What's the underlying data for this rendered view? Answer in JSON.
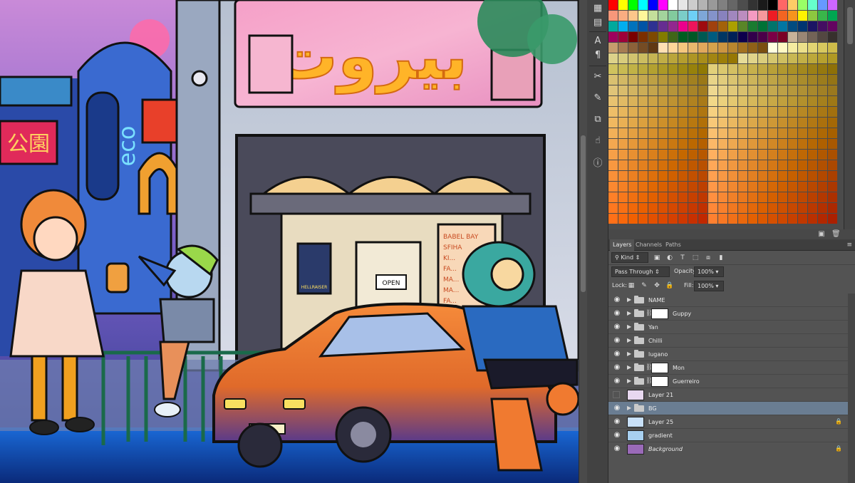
{
  "canvas": {
    "sign_text": "بيروت",
    "eco_sign": "eco",
    "chinese_sign": "公園",
    "menu_board": [
      "BABEL BAY",
      "SFIHA",
      "KI...",
      "FA...",
      "MA...",
      "MA...",
      "FA..."
    ],
    "poster_text": "HELLRAISER",
    "door_sign": "OPEN"
  },
  "iconstrip": {
    "icons": [
      "swatches-icon",
      "character-icon",
      "paragraph-icon",
      "tools-icon",
      "brush-presets-icon",
      "clone-source-icon",
      "actions-icon",
      "info-icon"
    ]
  },
  "swatches": {
    "colors": [
      [
        "#ff0000",
        "#ffff00",
        "#00ff00",
        "#00ffff",
        "#0000ff",
        "#ff00ff",
        "#ffffff",
        "#e6e6e6",
        "#cccccc",
        "#b3b3b3",
        "#999999",
        "#808080",
        "#666666",
        "#4d4d4d",
        "#333333",
        "#1a1a1a",
        "#000000",
        "#ff6666",
        "#ffcc66",
        "#99ff66",
        "#66ffcc",
        "#6699ff",
        "#cc66ff"
      ],
      [
        "#f7977a",
        "#f9ad81",
        "#fdc68a",
        "#fff79a",
        "#c4df9b",
        "#a3d39c",
        "#82ca9d",
        "#7bcdc8",
        "#6ecff6",
        "#7ea7d8",
        "#8493ca",
        "#8882be",
        "#a187be",
        "#bc8dbf",
        "#f49ac2",
        "#f6989d",
        "#ed1c24",
        "#f26522",
        "#f7941d",
        "#fff200",
        "#8dc73f",
        "#39b54a",
        "#00a651"
      ],
      [
        "#00a99d",
        "#00aeef",
        "#0072bc",
        "#0054a6",
        "#2e3192",
        "#662d91",
        "#92278f",
        "#ec008c",
        "#ed145b",
        "#9e0b0f",
        "#a0410d",
        "#a36209",
        "#aba000",
        "#598527",
        "#1a7b30",
        "#007236",
        "#00746b",
        "#0076a3",
        "#004b80",
        "#003471",
        "#1b1464",
        "#440e62",
        "#630460"
      ],
      [
        "#9e005d",
        "#9e0039",
        "#790000",
        "#7b2e00",
        "#7d4900",
        "#827b00",
        "#406618",
        "#005e20",
        "#005826",
        "#005952",
        "#005b7f",
        "#003663",
        "#002157",
        "#0d004c",
        "#32004b",
        "#4b0049",
        "#7b0046",
        "#7a0026",
        "#c7b299",
        "#998675",
        "#736357",
        "#534741",
        "#37302d"
      ],
      [
        "#c69c6d",
        "#a67c52",
        "#8c6239",
        "#754c24",
        "#603913",
        "#ffe0b3",
        "#ffd699",
        "#f5c77e",
        "#e8b86d",
        "#e0a85c",
        "#d4a24c",
        "#cc9540",
        "#b8862e",
        "#a37220",
        "#8f6018",
        "#7a4f10",
        "#ffffe0",
        "#fff8c4",
        "#f5eba0",
        "#ece08a",
        "#e2d472",
        "#d8c85e",
        "#cfbc4a"
      ],
      [
        "#ddd28a",
        "#d8cc7c",
        "#d2c46e",
        "#ccbd60",
        "#c6b553",
        "#c0ad46",
        "#baa53a",
        "#b49d2e",
        "#ae9524",
        "#a88d1a",
        "#a28512",
        "#9c7e0a",
        "#967704",
        "#e6dc98",
        "#e0d48a",
        "#dacd7c",
        "#d4c66e",
        "#cebe60",
        "#c8b753",
        "#c2af46",
        "#bca83a",
        "#b6a02e",
        "#b09924"
      ],
      [
        "#cfc25e",
        "#c8ba52",
        "#c1b246",
        "#baa93b",
        "#b3a130",
        "#ac9926",
        "#a5911c",
        "#9e8913",
        "#97810b",
        "#907904",
        "#e2d07a",
        "#dbc86e",
        "#d4c062",
        "#cdb857",
        "#c6b04c",
        "#bfa842",
        "#b8a038",
        "#b1982f",
        "#aa9026",
        "#a3881e",
        "#9c8016",
        "#95780f",
        "#8e7008"
      ],
      [
        "#d9c070",
        "#d2b864",
        "#cbb059",
        "#c4a84e",
        "#bda044",
        "#b6983a",
        "#af9031",
        "#a88828",
        "#a18020",
        "#9a7818",
        "#e8d488",
        "#e1cc7c",
        "#dac470",
        "#d3bc65",
        "#ccb45a",
        "#c5ac50",
        "#bea446",
        "#b79c3d",
        "#b09434",
        "#a98c2c",
        "#a28424",
        "#9b7c1d",
        "#947416"
      ],
      [
        "#e0c478",
        "#d9bc6c",
        "#d2b461",
        "#cbac56",
        "#c4a44c",
        "#bd9c42",
        "#b69439",
        "#af8c30",
        "#a88428",
        "#a17c20",
        "#eed890",
        "#e7d084",
        "#e0c878",
        "#d9c06d",
        "#d2b862",
        "#cbb058",
        "#c4a84e",
        "#bda045",
        "#b6983c",
        "#af9034",
        "#a8882c",
        "#a18025",
        "#9a781e"
      ],
      [
        "#e8c270",
        "#e1ba64",
        "#dab259",
        "#d3aa4e",
        "#cca244",
        "#c59a3a",
        "#be9231",
        "#b78a28",
        "#b08220",
        "#a97a18",
        "#f2d888",
        "#ebd07c",
        "#e4c870",
        "#ddc065",
        "#d6b85a",
        "#cfb050",
        "#c8a846",
        "#c1a03d",
        "#ba9834",
        "#b3902c",
        "#ac8824",
        "#a5801d",
        "#9e7816"
      ],
      [
        "#eebe68",
        "#e7b65c",
        "#e0ae51",
        "#d9a646",
        "#d29e3c",
        "#cb9632",
        "#c48e29",
        "#bd8620",
        "#b67e18",
        "#af7610",
        "#f6d080",
        "#efc874",
        "#e8c068",
        "#e1b85d",
        "#dab052",
        "#d3a848",
        "#cca03e",
        "#c59835",
        "#be902c",
        "#b78824",
        "#b0801c",
        "#a97815",
        "#a2700e"
      ],
      [
        "#f0b860",
        "#e9b054",
        "#e2a849",
        "#dba03e",
        "#d49834",
        "#cd902a",
        "#c68821",
        "#bf8018",
        "#b87810",
        "#b17008",
        "#f8c878",
        "#f1c06c",
        "#eab860",
        "#e3b055",
        "#dca84a",
        "#d5a040",
        "#ce9836",
        "#c7902d",
        "#c08824",
        "#b9801c",
        "#b27814",
        "#ab700d",
        "#a46806"
      ],
      [
        "#f2b058",
        "#eba84c",
        "#e4a041",
        "#dd9836",
        "#d6902c",
        "#cf8822",
        "#c88019",
        "#c17810",
        "#ba7008",
        "#b36800",
        "#fac070",
        "#f3b864",
        "#ecb058",
        "#e5a84d",
        "#dea042",
        "#d79838",
        "#d0902e",
        "#c98825",
        "#c2801c",
        "#bb7814",
        "#b4700c",
        "#ad6805",
        "#a66000"
      ],
      [
        "#f4a850",
        "#eda044",
        "#e69839",
        "#df902e",
        "#d88824",
        "#d1801a",
        "#ca7811",
        "#c37008",
        "#bc6800",
        "#b56000",
        "#fcb868",
        "#f5b05c",
        "#eea850",
        "#e7a045",
        "#e0983a",
        "#d99030",
        "#d28826",
        "#cb801d",
        "#c47814",
        "#bd700c",
        "#b66804",
        "#af6000",
        "#a85800"
      ],
      [
        "#f6a048",
        "#ef983c",
        "#e89031",
        "#e18826",
        "#da801c",
        "#d37812",
        "#cc7009",
        "#c56800",
        "#be6000",
        "#b75800",
        "#feb060",
        "#f7a854",
        "#f0a048",
        "#e9983d",
        "#e29032",
        "#db8828",
        "#d4801e",
        "#cd7815",
        "#c6700c",
        "#bf6804",
        "#b86000",
        "#b15800",
        "#aa5000"
      ],
      [
        "#f89840",
        "#f19034",
        "#ea8829",
        "#e3801e",
        "#dc7814",
        "#d5700a",
        "#ce6801",
        "#c76000",
        "#c05800",
        "#b95000",
        "#ffa858",
        "#f8a04c",
        "#f19840",
        "#ea9035",
        "#e3882a",
        "#dc8020",
        "#d57816",
        "#ce700d",
        "#c76804",
        "#c06000",
        "#b95800",
        "#b25000",
        "#ab4800"
      ],
      [
        "#fa9038",
        "#f3882c",
        "#ec8021",
        "#e57816",
        "#de700c",
        "#d76802",
        "#d06000",
        "#c95800",
        "#c25000",
        "#bb4800",
        "#ffa050",
        "#f89844",
        "#f19038",
        "#ea882d",
        "#e38022",
        "#dc7818",
        "#d5700e",
        "#ce6805",
        "#c76000",
        "#c05800",
        "#b95000",
        "#b24800",
        "#ab4000"
      ],
      [
        "#fc8830",
        "#f58024",
        "#ee7819",
        "#e7700e",
        "#e06804",
        "#d96000",
        "#d25800",
        "#cb5000",
        "#c44800",
        "#bd4000",
        "#ff9848",
        "#f8903c",
        "#f18830",
        "#ea8025",
        "#e3781a",
        "#dc7010",
        "#d56806",
        "#ce6000",
        "#c75800",
        "#c05000",
        "#b94800",
        "#b24000",
        "#ab3800"
      ],
      [
        "#fe8028",
        "#f7781c",
        "#f07011",
        "#e96806",
        "#e26000",
        "#db5800",
        "#d45000",
        "#cd4800",
        "#c64000",
        "#bf3800",
        "#ff9040",
        "#f88834",
        "#f18028",
        "#ea781d",
        "#e37012",
        "#dc6808",
        "#d56000",
        "#ce5800",
        "#c75000",
        "#c04800",
        "#b94000",
        "#b23800",
        "#ab3000"
      ],
      [
        "#ff7820",
        "#f87014",
        "#f16809",
        "#ea6000",
        "#e35800",
        "#dc5000",
        "#d54800",
        "#ce4000",
        "#c73800",
        "#c03000",
        "#ff8838",
        "#f8802c",
        "#f17820",
        "#ea7015",
        "#e3680a",
        "#dc6000",
        "#d55800",
        "#ce5000",
        "#c74800",
        "#c04000",
        "#b93800",
        "#b23000",
        "#ab2800"
      ],
      [
        "#ff7018",
        "#f8680c",
        "#f16001",
        "#ea5800",
        "#e35000",
        "#dc4800",
        "#d54000",
        "#ce3800",
        "#c73000",
        "#c02800",
        "#ff8030",
        "#f87824",
        "#f17018",
        "#ea680d",
        "#e36002",
        "#dc5800",
        "#d55000",
        "#ce4800",
        "#c74000",
        "#c03800",
        "#b93000",
        "#b22800",
        "#ab2000"
      ]
    ]
  },
  "layers_panel": {
    "tabs": [
      "Layers",
      "Channels",
      "Paths"
    ],
    "filter_kind": "Kind",
    "blend_mode": "Pass Through",
    "opacity_label": "Opacity:",
    "opacity_value": "100%",
    "lock_label": "Lock:",
    "fill_label": "Fill:",
    "fill_value": "100%",
    "layers": [
      {
        "name": "NAME",
        "type": "group",
        "visible": true,
        "mask": false,
        "selected": false,
        "locked": false,
        "italic": false
      },
      {
        "name": "Guppy",
        "type": "group",
        "visible": true,
        "mask": true,
        "selected": false,
        "locked": false,
        "italic": false
      },
      {
        "name": "Yan",
        "type": "group",
        "visible": true,
        "mask": false,
        "selected": false,
        "locked": false,
        "italic": false
      },
      {
        "name": "Chilli",
        "type": "group",
        "visible": true,
        "mask": false,
        "selected": false,
        "locked": false,
        "italic": false
      },
      {
        "name": "lugano",
        "type": "group",
        "visible": true,
        "mask": false,
        "selected": false,
        "locked": false,
        "italic": false
      },
      {
        "name": "Mon",
        "type": "group",
        "visible": true,
        "mask": true,
        "selected": false,
        "locked": false,
        "italic": false
      },
      {
        "name": "Guerreiro",
        "type": "group",
        "visible": true,
        "mask": true,
        "selected": false,
        "locked": false,
        "italic": false
      },
      {
        "name": "Layer 21",
        "type": "layer",
        "visible": false,
        "mask": false,
        "selected": false,
        "locked": false,
        "italic": false
      },
      {
        "name": "BG",
        "type": "group",
        "visible": true,
        "mask": false,
        "selected": true,
        "locked": false,
        "italic": false
      },
      {
        "name": "Layer 25",
        "type": "layer",
        "visible": true,
        "mask": false,
        "selected": false,
        "locked": true,
        "italic": false
      },
      {
        "name": "gradient",
        "type": "layer",
        "visible": true,
        "mask": false,
        "selected": false,
        "locked": false,
        "italic": false
      },
      {
        "name": "Background",
        "type": "layer",
        "visible": true,
        "mask": false,
        "selected": false,
        "locked": true,
        "italic": true
      }
    ],
    "thumb_colors": {
      "Layer 21": "#e8d8f0",
      "Layer 25": "#c8e0f8",
      "gradient": "#a8d0f0",
      "Background": "#9a6ab8"
    }
  }
}
